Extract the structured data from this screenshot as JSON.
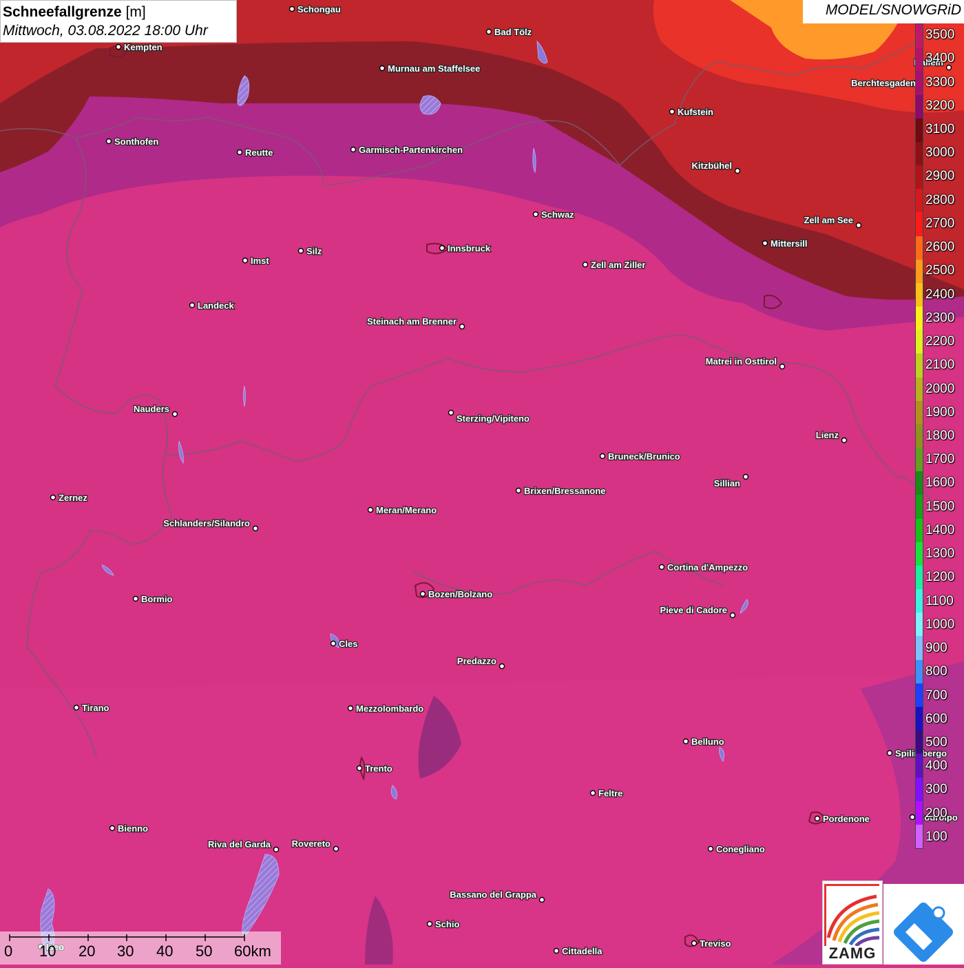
{
  "header": {
    "title_bold": "Schneefallgrenze",
    "title_unit": " [m]",
    "subtitle": "Mittwoch, 03.08.2022 18:00 Uhr",
    "model": "MODEL/SNOWGRiD"
  },
  "legend": {
    "labels": [
      "3500",
      "3400",
      "3300",
      "3200",
      "3100",
      "3000",
      "2900",
      "2800",
      "2700",
      "2600",
      "2500",
      "2400",
      "2300",
      "2200",
      "2100",
      "2000",
      "1900",
      "1800",
      "1700",
      "1600",
      "1500",
      "1400",
      "1300",
      "1200",
      "1100",
      "1000",
      "900",
      "800",
      "700",
      "600",
      "500",
      "400",
      "300",
      "200",
      "100"
    ],
    "colors": [
      "#c2186b",
      "#b5126a",
      "#a81070",
      "#8a0a6e",
      "#6e0a10",
      "#8e0f14",
      "#b01418",
      "#d41a1c",
      "#ff1a1a",
      "#ff6a1a",
      "#ff9a1a",
      "#ffbf1a",
      "#ffef1a",
      "#e0f020",
      "#c0d020",
      "#b8b020",
      "#b09020",
      "#909020",
      "#60a020",
      "#1a8a1a",
      "#1aa01a",
      "#1ac01a",
      "#1ae040",
      "#1af0a0",
      "#40f0e0",
      "#80f0ff",
      "#80c0ff",
      "#4090ff",
      "#1a40ff",
      "#1a10c0",
      "#3a0a80",
      "#6010c0",
      "#8010ff",
      "#b010ff",
      "#d060ff"
    ]
  },
  "map": {
    "colors": {
      "base": "#d63384",
      "north_purple": "#b02a8a",
      "north_darkred": "#8a1f2a",
      "north_red": "#c0262c",
      "north_brightred": "#e8322a",
      "orange": "#ff9a2a",
      "border": "#7a5a70"
    },
    "cities": [
      {
        "id": "schongau",
        "name": "Schongau"
      },
      {
        "id": "bad-toelz",
        "name": "Bad Tölz"
      },
      {
        "id": "kempten",
        "name": "Kempten"
      },
      {
        "id": "murnau",
        "name": "Murnau am Staffelsee"
      },
      {
        "id": "hallein",
        "name": "Hallein"
      },
      {
        "id": "berchtesgaden",
        "name": "Berchtesgaden"
      },
      {
        "id": "kufstein",
        "name": "Kufstein"
      },
      {
        "id": "sonthofen",
        "name": "Sonthofen"
      },
      {
        "id": "reutte",
        "name": "Reutte"
      },
      {
        "id": "garmisch",
        "name": "Garmisch-Partenkirchen"
      },
      {
        "id": "kitzbuehel",
        "name": "Kitzbühel"
      },
      {
        "id": "schwaz",
        "name": "Schwaz"
      },
      {
        "id": "zell-am-see",
        "name": "Zell am See"
      },
      {
        "id": "mittersill",
        "name": "Mittersill"
      },
      {
        "id": "innsbruck",
        "name": "Innsbruck"
      },
      {
        "id": "silz",
        "name": "Silz"
      },
      {
        "id": "imst",
        "name": "Imst"
      },
      {
        "id": "zell-am-ziller",
        "name": "Zell am Ziller"
      },
      {
        "id": "landeck",
        "name": "Landeck"
      },
      {
        "id": "steinach",
        "name": "Steinach am Brenner"
      },
      {
        "id": "matrei",
        "name": "Matrei in Osttirol"
      },
      {
        "id": "nauders",
        "name": "Nauders"
      },
      {
        "id": "sterzing",
        "name": "Sterzing/Vipiteno"
      },
      {
        "id": "lienz",
        "name": "Lienz"
      },
      {
        "id": "bruneck",
        "name": "Bruneck/Brunico"
      },
      {
        "id": "sillian",
        "name": "Sillian"
      },
      {
        "id": "brixen",
        "name": "Brixen/Bressanone"
      },
      {
        "id": "zernez",
        "name": "Zernez"
      },
      {
        "id": "meran",
        "name": "Meran/Merano"
      },
      {
        "id": "schlanders",
        "name": "Schlanders/Silandro"
      },
      {
        "id": "cortina",
        "name": "Cortina d'Ampezzo"
      },
      {
        "id": "bozen",
        "name": "Bozen/Bolzano"
      },
      {
        "id": "bormio",
        "name": "Bormio"
      },
      {
        "id": "pieve",
        "name": "Pieve di Cadore"
      },
      {
        "id": "cles",
        "name": "Cles"
      },
      {
        "id": "predazzo",
        "name": "Predazzo"
      },
      {
        "id": "tirano",
        "name": "Tirano"
      },
      {
        "id": "mezzolombardo",
        "name": "Mezzolombardo"
      },
      {
        "id": "belluno",
        "name": "Belluno"
      },
      {
        "id": "spilimbergo",
        "name": "Spilimbergo"
      },
      {
        "id": "trento",
        "name": "Trento"
      },
      {
        "id": "feltre",
        "name": "Feltre"
      },
      {
        "id": "pordenone",
        "name": "Pordenone"
      },
      {
        "id": "codroipo",
        "name": "Codroipo"
      },
      {
        "id": "bienno",
        "name": "Bienno"
      },
      {
        "id": "riva",
        "name": "Riva del Garda"
      },
      {
        "id": "rovereto",
        "name": "Rovereto"
      },
      {
        "id": "conegliano",
        "name": "Conegliano"
      },
      {
        "id": "bassano",
        "name": "Bassano del Grappa"
      },
      {
        "id": "schio",
        "name": "Schio"
      },
      {
        "id": "iseo",
        "name": "Iseo"
      },
      {
        "id": "treviso",
        "name": "Treviso"
      },
      {
        "id": "cittadella",
        "name": "Cittadella"
      }
    ]
  },
  "scalebar": {
    "ticks": [
      "0",
      "10",
      "20",
      "30",
      "40",
      "50",
      "60km"
    ]
  },
  "logos": {
    "zamg": "ZAMG"
  }
}
